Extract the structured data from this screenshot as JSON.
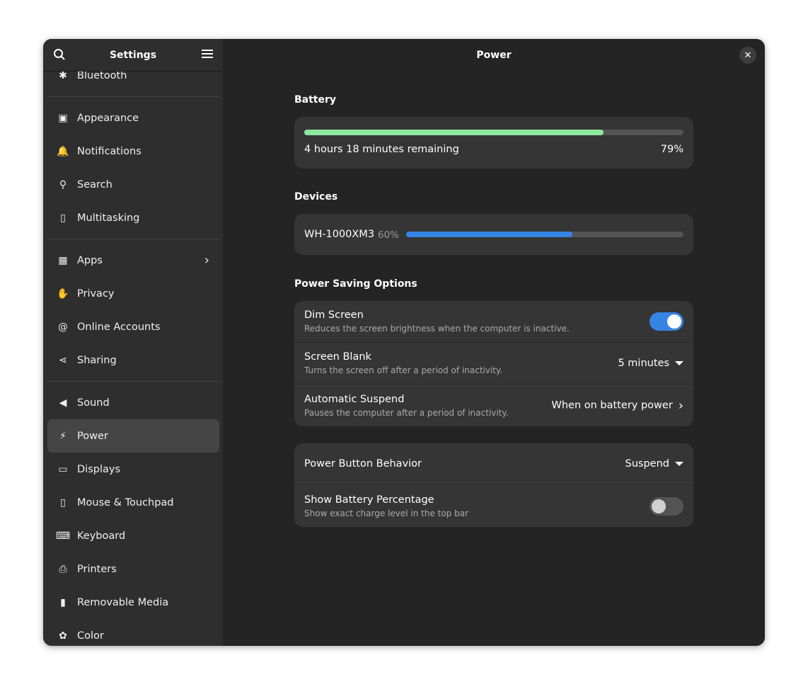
{
  "sidebar": {
    "title": "Settings",
    "items": [
      {
        "label": "Bluetooth",
        "icon": "bluetooth-icon",
        "g": "✱"
      },
      {
        "sep": true
      },
      {
        "label": "Appearance",
        "icon": "appearance-icon",
        "g": "▣"
      },
      {
        "label": "Notifications",
        "icon": "bell-icon",
        "g": "🔔"
      },
      {
        "label": "Search",
        "icon": "search-icon",
        "g": "⚲"
      },
      {
        "label": "Multitasking",
        "icon": "multitasking-icon",
        "g": "▯"
      },
      {
        "sep": true
      },
      {
        "label": "Apps",
        "icon": "apps-icon",
        "g": "▦",
        "chevron": true
      },
      {
        "label": "Privacy",
        "icon": "hand-icon",
        "g": "✋"
      },
      {
        "label": "Online Accounts",
        "icon": "at-icon",
        "g": "@"
      },
      {
        "label": "Sharing",
        "icon": "share-icon",
        "g": "⋖"
      },
      {
        "sep": true
      },
      {
        "label": "Sound",
        "icon": "speaker-icon",
        "g": "◀"
      },
      {
        "label": "Power",
        "icon": "power-icon",
        "g": "⚡",
        "selected": true
      },
      {
        "label": "Displays",
        "icon": "display-icon",
        "g": "▭"
      },
      {
        "label": "Mouse & Touchpad",
        "icon": "mouse-icon",
        "g": "▯"
      },
      {
        "label": "Keyboard",
        "icon": "keyboard-icon",
        "g": "⌨"
      },
      {
        "label": "Printers",
        "icon": "printer-icon",
        "g": "⎙"
      },
      {
        "label": "Removable Media",
        "icon": "usb-icon",
        "g": "▮"
      },
      {
        "label": "Color",
        "icon": "color-icon",
        "g": "✿"
      }
    ]
  },
  "main": {
    "title": "Power",
    "battery": {
      "heading": "Battery",
      "remaining": "4 hours 18 minutes remaining",
      "percent": "79%",
      "level": 79,
      "color": "#8de89f"
    },
    "devices": {
      "heading": "Devices",
      "items": [
        {
          "name": "WH-1000XM3",
          "percent": "60%",
          "level": 60,
          "color": "#3584e4"
        }
      ]
    },
    "power_saving": {
      "heading": "Power Saving Options",
      "dim": {
        "title": "Dim Screen",
        "subtitle": "Reduces the screen brightness when the computer is inactive.",
        "on": true
      },
      "blank": {
        "title": "Screen Blank",
        "subtitle": "Turns the screen off after a period of inactivity.",
        "value": "5 minutes"
      },
      "suspend": {
        "title": "Automatic Suspend",
        "subtitle": "Pauses the computer after a period of inactivity.",
        "value": "When on battery power"
      }
    },
    "general": {
      "button": {
        "title": "Power Button Behavior",
        "value": "Suspend"
      },
      "percentage": {
        "title": "Show Battery Percentage",
        "subtitle": "Show exact charge level in the top bar",
        "on": false
      }
    }
  },
  "colors": {
    "accent": "#3584e4",
    "battery": "#8de89f"
  }
}
